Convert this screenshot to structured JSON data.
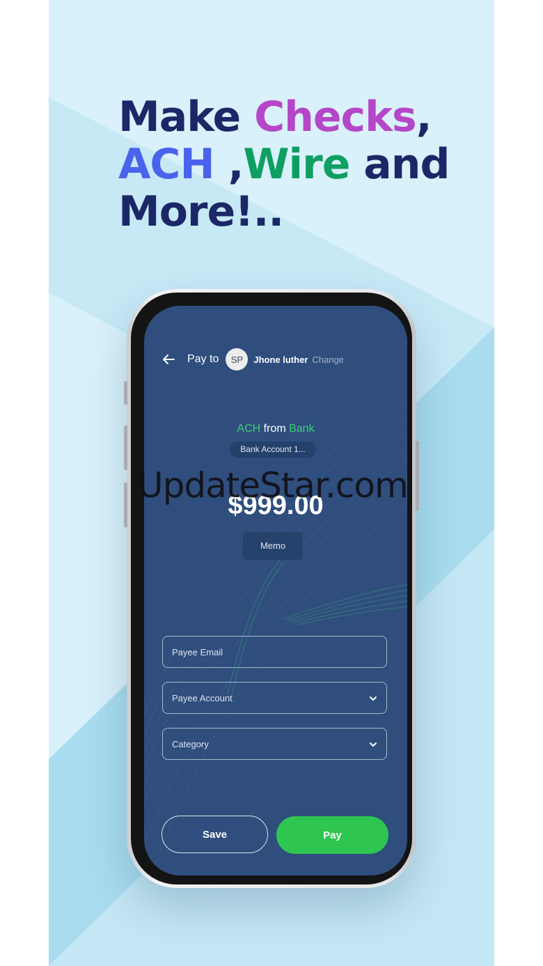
{
  "headline": {
    "part1": "Make ",
    "part2": "Checks",
    "part3": ",",
    "part4": "ACH",
    "part5": " ,",
    "part6": "Wire",
    "part7": " and",
    "part8": "More!.."
  },
  "colors": {
    "navy": "#1b2766",
    "purple": "#b546c8",
    "blue": "#4a63ec",
    "green": "#0f9f62",
    "screen": "#2f4e7d",
    "pay_button": "#2ec650"
  },
  "app": {
    "back_icon": "arrow-left-icon",
    "pay_to_label": "Pay to",
    "payee_initials": "SP",
    "payee_name": "Jhone luther",
    "change_label": "Change",
    "method_part1": "ACH",
    "method_part2": " from ",
    "method_part3": "Bank",
    "account_label": "Bank Account 1...",
    "amount": "$999.00",
    "memo_label": "Memo",
    "fields": {
      "payee_email": "Payee Email",
      "payee_account": "Payee Account",
      "category": "Category"
    },
    "save_label": "Save",
    "pay_label": "Pay"
  },
  "watermark": "UpdateStar.com"
}
